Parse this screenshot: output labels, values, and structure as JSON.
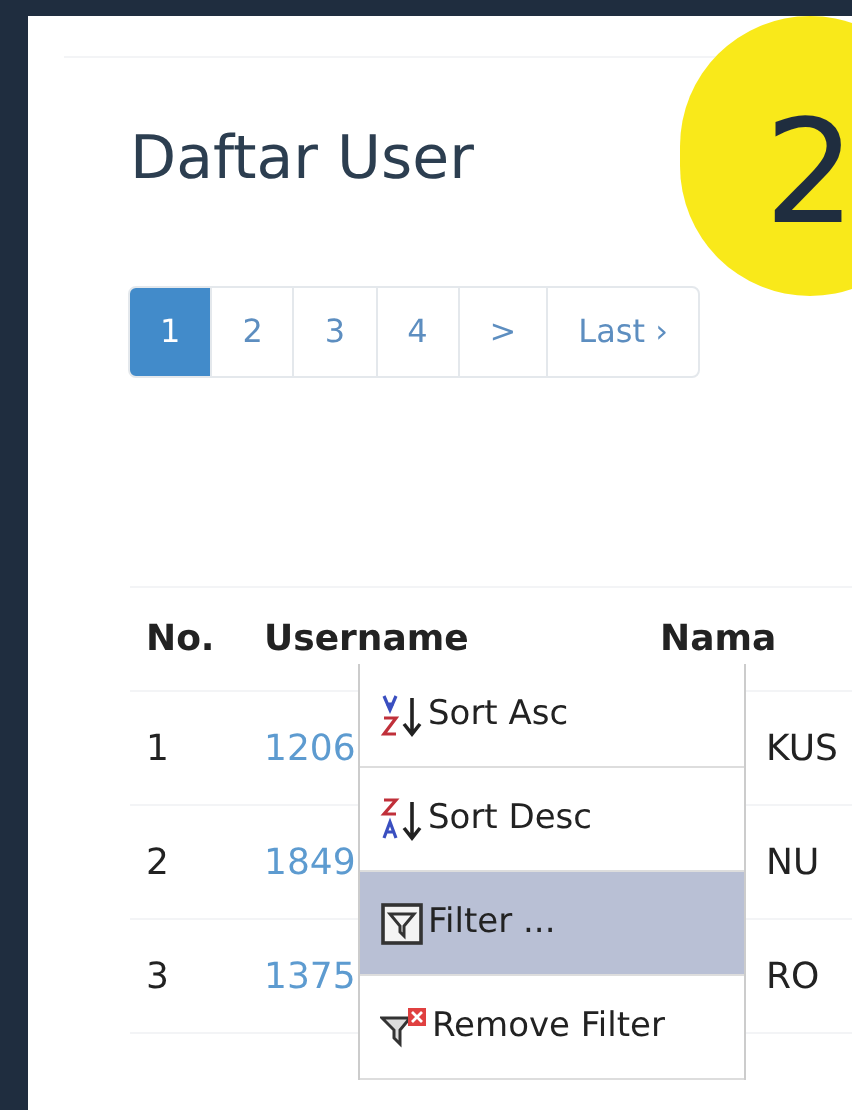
{
  "badge": "2",
  "title": "Daftar User",
  "pagination": [
    {
      "label": "1",
      "selected": true
    },
    {
      "label": "2",
      "selected": false
    },
    {
      "label": "3",
      "selected": false
    },
    {
      "label": "4",
      "selected": false
    },
    {
      "label": ">",
      "selected": false
    },
    {
      "label": "Last ›",
      "selected": false
    }
  ],
  "table": {
    "columns": [
      "No.",
      "Username",
      "Nama"
    ],
    "rows": [
      [
        "1",
        "1206",
        "KUS"
      ],
      [
        "2",
        "1849",
        "NU"
      ],
      [
        "3",
        "1375",
        "RO"
      ]
    ]
  },
  "context_menu": [
    {
      "kind": "sort-asc",
      "label": "Sort Asc",
      "selected": false
    },
    {
      "kind": "sort-desc",
      "label": "Sort Desc",
      "selected": false
    },
    {
      "kind": "filter",
      "label": "Filter ...",
      "selected": true
    },
    {
      "kind": "remove-filter",
      "label": "Remove Filter",
      "selected": false
    }
  ]
}
